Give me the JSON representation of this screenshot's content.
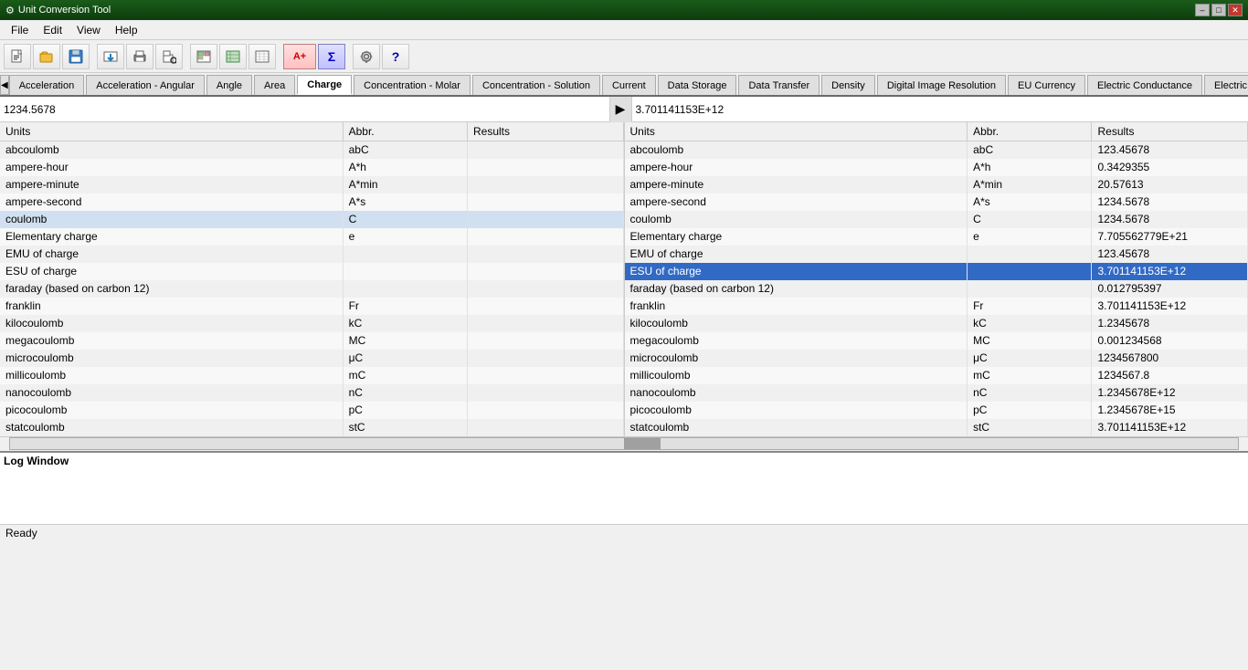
{
  "app": {
    "title": "Unit Conversion Tool",
    "icon": "⚙"
  },
  "titlebar": {
    "minimize_label": "–",
    "maximize_label": "□",
    "close_label": "✕"
  },
  "menu": {
    "items": [
      "File",
      "Edit",
      "View",
      "Help"
    ]
  },
  "toolbar": {
    "buttons": [
      {
        "name": "new",
        "icon": "📄"
      },
      {
        "name": "open",
        "icon": "📂"
      },
      {
        "name": "save",
        "icon": "💾"
      },
      {
        "name": "import",
        "icon": "📥"
      },
      {
        "name": "print",
        "icon": "🖨"
      },
      {
        "name": "print-preview",
        "icon": "🔍"
      },
      {
        "name": "export1",
        "icon": "📊"
      },
      {
        "name": "export2",
        "icon": "📤"
      },
      {
        "name": "export3",
        "icon": "📋"
      },
      {
        "name": "formula",
        "icon": "A+"
      },
      {
        "name": "sigma",
        "icon": "Σ"
      },
      {
        "name": "settings",
        "icon": "🔧"
      },
      {
        "name": "help",
        "icon": "?"
      }
    ]
  },
  "tabs": {
    "items": [
      {
        "label": "Acceleration",
        "active": false
      },
      {
        "label": "Acceleration - Angular",
        "active": false
      },
      {
        "label": "Angle",
        "active": false
      },
      {
        "label": "Area",
        "active": false
      },
      {
        "label": "Charge",
        "active": true
      },
      {
        "label": "Concentration - Molar",
        "active": false
      },
      {
        "label": "Concentration - Solution",
        "active": false
      },
      {
        "label": "Current",
        "active": false
      },
      {
        "label": "Data Storage",
        "active": false
      },
      {
        "label": "Data Transfer",
        "active": false
      },
      {
        "label": "Density",
        "active": false
      },
      {
        "label": "Digital Image Resolution",
        "active": false
      },
      {
        "label": "EU Currency",
        "active": false
      },
      {
        "label": "Electric Conductance",
        "active": false
      },
      {
        "label": "Electric Condu",
        "active": false
      }
    ],
    "nav_left": "◀",
    "nav_right": "▶"
  },
  "input": {
    "left_value": "1234.5678",
    "right_value": "3.701141153E+12",
    "arrow": "▶"
  },
  "left_table": {
    "columns": [
      "Units",
      "Abbr.",
      "Results"
    ],
    "rows": [
      {
        "units": "abcoulomb",
        "abbr": "abC",
        "results": ""
      },
      {
        "units": "ampere-hour",
        "abbr": "A*h",
        "results": ""
      },
      {
        "units": "ampere-minute",
        "abbr": "A*min",
        "results": ""
      },
      {
        "units": "ampere-second",
        "abbr": "A*s",
        "results": ""
      },
      {
        "units": "coulomb",
        "abbr": "C",
        "results": "",
        "highlight": true
      },
      {
        "units": "Elementary charge",
        "abbr": "e",
        "results": ""
      },
      {
        "units": "EMU of charge",
        "abbr": "",
        "results": ""
      },
      {
        "units": "ESU of charge",
        "abbr": "",
        "results": ""
      },
      {
        "units": "faraday (based on carbon 12)",
        "abbr": "",
        "results": ""
      },
      {
        "units": "franklin",
        "abbr": "Fr",
        "results": ""
      },
      {
        "units": "kilocoulomb",
        "abbr": "kC",
        "results": ""
      },
      {
        "units": "megacoulomb",
        "abbr": "MC",
        "results": ""
      },
      {
        "units": "microcoulomb",
        "abbr": "μC",
        "results": ""
      },
      {
        "units": "millicoulomb",
        "abbr": "mC",
        "results": ""
      },
      {
        "units": "nanocoulomb",
        "abbr": "nC",
        "results": ""
      },
      {
        "units": "picocoulomb",
        "abbr": "pC",
        "results": ""
      },
      {
        "units": "statcoulomb",
        "abbr": "stC",
        "results": ""
      }
    ]
  },
  "right_table": {
    "columns": [
      "Units",
      "Abbr.",
      "Results"
    ],
    "rows": [
      {
        "units": "abcoulomb",
        "abbr": "abC",
        "results": "123.45678"
      },
      {
        "units": "ampere-hour",
        "abbr": "A*h",
        "results": "0.3429355"
      },
      {
        "units": "ampere-minute",
        "abbr": "A*min",
        "results": "20.57613"
      },
      {
        "units": "ampere-second",
        "abbr": "A*s",
        "results": "1234.5678"
      },
      {
        "units": "coulomb",
        "abbr": "C",
        "results": "1234.5678"
      },
      {
        "units": "Elementary charge",
        "abbr": "e",
        "results": "7.705562779E+21"
      },
      {
        "units": "EMU of charge",
        "abbr": "",
        "results": "123.45678"
      },
      {
        "units": "ESU of charge",
        "abbr": "",
        "results": "3.701141153E+12",
        "selected": true
      },
      {
        "units": "faraday (based on carbon 12)",
        "abbr": "",
        "results": "0.012795397"
      },
      {
        "units": "franklin",
        "abbr": "Fr",
        "results": "3.701141153E+12"
      },
      {
        "units": "kilocoulomb",
        "abbr": "kC",
        "results": "1.2345678"
      },
      {
        "units": "megacoulomb",
        "abbr": "MC",
        "results": "0.001234568"
      },
      {
        "units": "microcoulomb",
        "abbr": "μC",
        "results": "1234567800"
      },
      {
        "units": "millicoulomb",
        "abbr": "mC",
        "results": "1234567.8"
      },
      {
        "units": "nanocoulomb",
        "abbr": "nC",
        "results": "1.2345678E+12"
      },
      {
        "units": "picocoulomb",
        "abbr": "pC",
        "results": "1.2345678E+15"
      },
      {
        "units": "statcoulomb",
        "abbr": "stC",
        "results": "3.701141153E+12"
      }
    ]
  },
  "log": {
    "label": "Log Window"
  },
  "statusbar": {
    "text": "Ready"
  }
}
